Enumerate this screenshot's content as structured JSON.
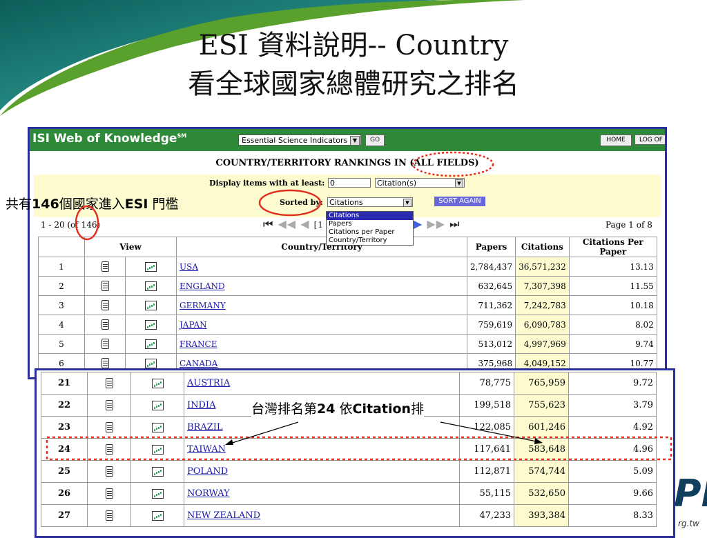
{
  "slide": {
    "title_line1": "ESI 資料說明-- Country",
    "title_line2": "看全球國家總體研究之排名"
  },
  "isi": {
    "logo": "ISI Web of Knowledge",
    "logo_sup": "SM",
    "db_select": "Essential Science Indicators",
    "go_label": "GO",
    "home_label": "HOME",
    "logoff_label": "LOG OF",
    "ranking_heading": "COUNTRY/TERRITORY RANKINGS IN (ALL FIELDS)",
    "display_label": "Display items with at least:",
    "display_value": "0",
    "display_unit": "Citation(s)",
    "sorted_label": "Sorted by:",
    "sorted_value": "Citations",
    "sort_again": "SORT AGAIN",
    "sort_options": [
      "Citations",
      "Papers",
      "Citations per Paper",
      "Country/Territory"
    ],
    "range_text": "1 - 20 (of 146)",
    "page_middle": "[1 |",
    "page_text": "Page 1 of 8"
  },
  "table_headers": {
    "view": "View",
    "country": "Country/Territory",
    "papers": "Papers",
    "citations": "Citations",
    "cpp": "Citations Per Paper"
  },
  "rows_top": [
    {
      "rank": "1",
      "country": "USA",
      "papers": "2,784,437",
      "citations": "36,571,232",
      "cpp": "13.13"
    },
    {
      "rank": "2",
      "country": "ENGLAND",
      "papers": "632,645",
      "citations": "7,307,398",
      "cpp": "11.55"
    },
    {
      "rank": "3",
      "country": "GERMANY",
      "papers": "711,362",
      "citations": "7,242,783",
      "cpp": "10.18"
    },
    {
      "rank": "4",
      "country": "JAPAN",
      "papers": "759,619",
      "citations": "6,090,783",
      "cpp": "8.02"
    },
    {
      "rank": "5",
      "country": "FRANCE",
      "papers": "513,012",
      "citations": "4,997,969",
      "cpp": "9.74"
    },
    {
      "rank": "6",
      "country": "CANADA",
      "papers": "375,968",
      "citations": "4,049,152",
      "cpp": "10.77"
    }
  ],
  "rows_bottom": [
    {
      "rank": "21",
      "country": "AUSTRIA",
      "papers": "78,775",
      "citations": "765,959",
      "cpp": "9.72"
    },
    {
      "rank": "22",
      "country": "INDIA",
      "papers": "199,518",
      "citations": "755,623",
      "cpp": "3.79"
    },
    {
      "rank": "23",
      "country": "BRAZIL",
      "papers": "122,085",
      "citations": "601,246",
      "cpp": "4.92"
    },
    {
      "rank": "24",
      "country": "TAIWAN",
      "papers": "117,641",
      "citations": "583,648",
      "cpp": "4.96"
    },
    {
      "rank": "25",
      "country": "POLAND",
      "papers": "112,871",
      "citations": "574,744",
      "cpp": "5.09"
    },
    {
      "rank": "26",
      "country": "NORWAY",
      "papers": "55,115",
      "citations": "532,650",
      "cpp": "9.66"
    },
    {
      "rank": "27",
      "country": "NEW ZEALAND",
      "papers": "47,233",
      "citations": "393,384",
      "cpp": "8.33"
    }
  ],
  "annotations": {
    "left_prefix": "共有",
    "left_count": "146",
    "left_mid": "個國家進入",
    "left_bold2": "ESI",
    "left_suffix": " 門檻",
    "mid_prefix": "台灣排名第",
    "mid_rank": "24",
    "mid_mid": " 依",
    "mid_bold": "Citation",
    "mid_suffix": "排"
  },
  "logo": {
    "mark": "PI",
    "url": "rg.tw"
  },
  "colors": {
    "isi_green": "#2e8a39",
    "frame_blue": "#2b2f9c",
    "highlight_yellow": "#fdfbd0",
    "annotation_red": "#e0301e",
    "swoosh_teal": "#1e8a86"
  }
}
